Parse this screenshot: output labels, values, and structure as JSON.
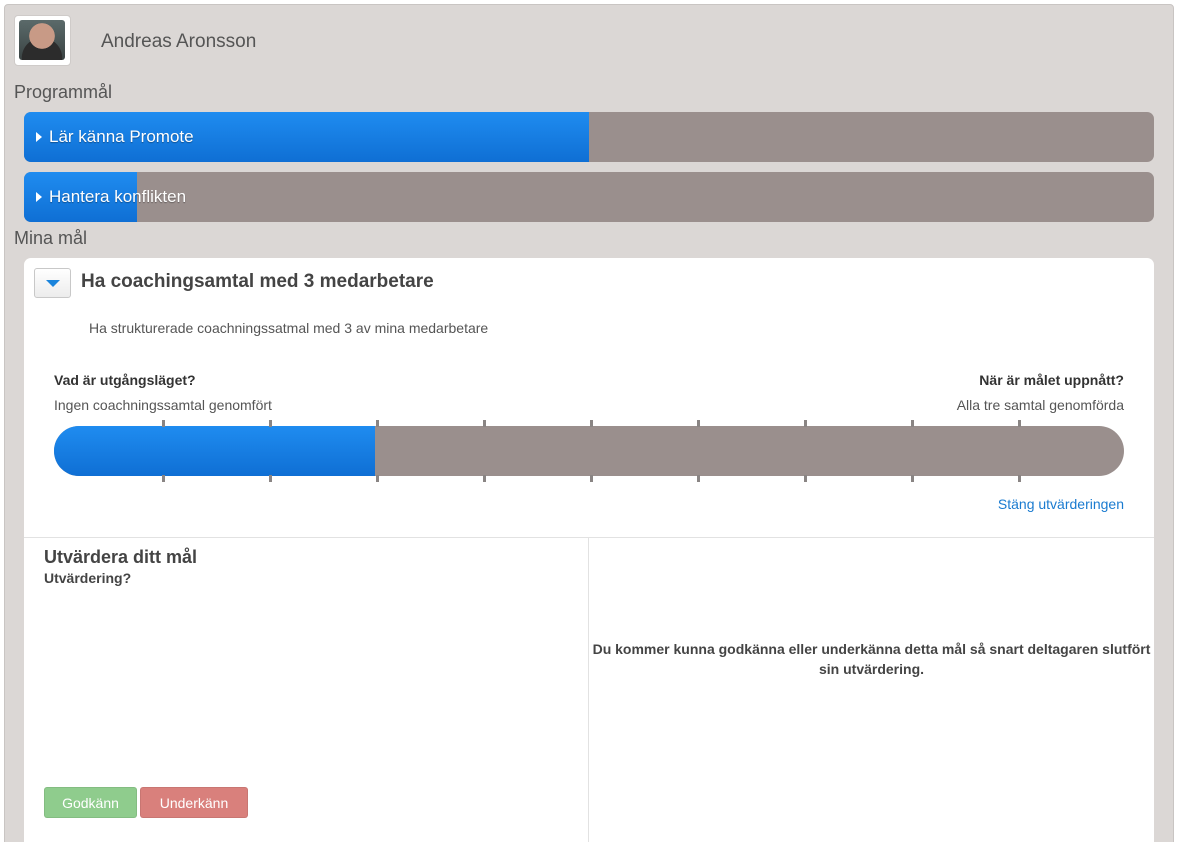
{
  "user": {
    "name": "Andreas Aronsson"
  },
  "program_goals": {
    "heading": "Programmål",
    "items": [
      {
        "label": "Lär känna Promote",
        "progress": 0.5
      },
      {
        "label": "Hantera konflikten",
        "progress": 0.1
      }
    ]
  },
  "my_goals": {
    "heading": "Mina mål",
    "goal": {
      "title": "Ha coachingsamtal med 3 medarbetare",
      "description": "Ha strukturerade coachningssatmal med 3 av mina medarbetare",
      "start_question": "Vad är utgångsläget?",
      "start_answer": "Ingen coachningssamtal genomfört",
      "end_question": "När är målet uppnått?",
      "end_answer": "Alla tre samtal genomförda",
      "progress": 0.3,
      "close_link": "Stäng utvärderingen"
    },
    "evaluation": {
      "title": "Utvärdera ditt mål",
      "subtitle": "Utvärdering?",
      "info": "Du kommer kunna godkänna eller underkänna detta mål så snart deltagaren slutfört sin utvärdering.",
      "approve_label": "Godkänn",
      "reject_label": "Underkänn"
    }
  },
  "colors": {
    "accent": "#1a84dc",
    "track": "#9a8f8d",
    "approve": "#8fcc8d",
    "reject": "#d9807c"
  }
}
